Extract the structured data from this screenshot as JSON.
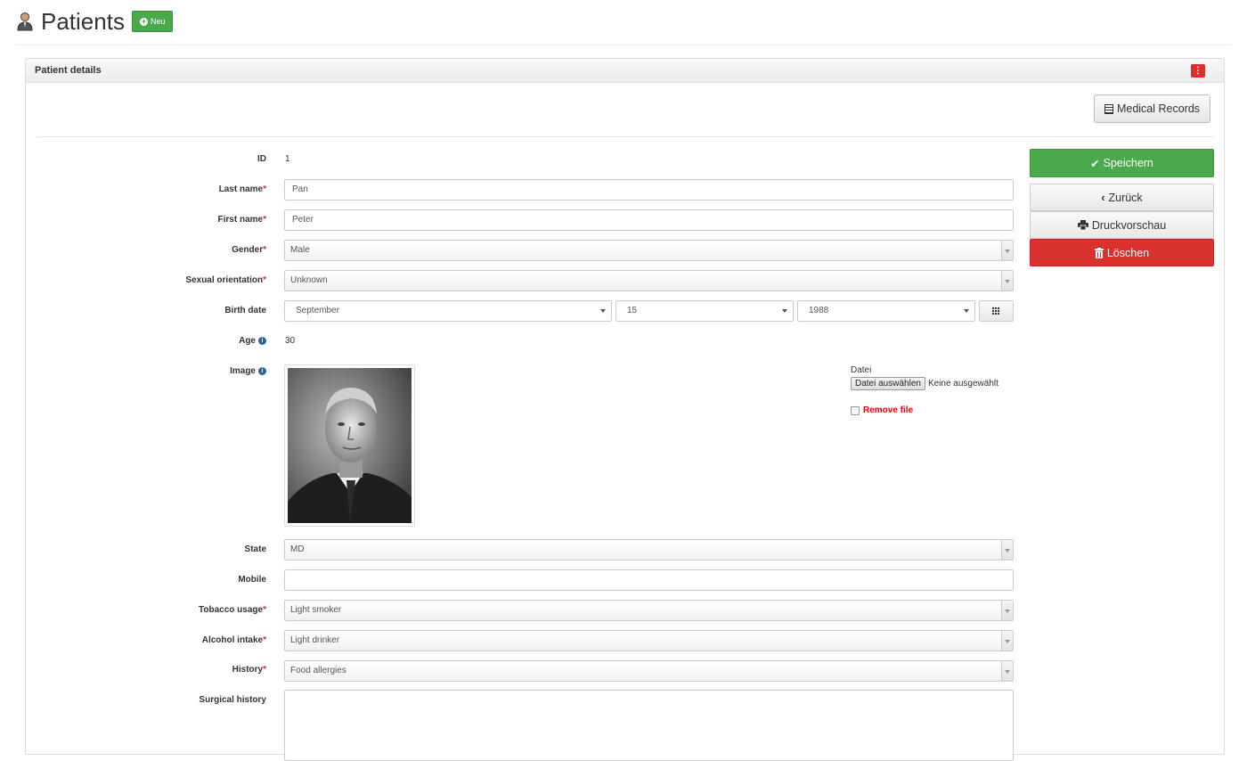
{
  "header": {
    "title": "Patients",
    "new_label": "Neu"
  },
  "panel": {
    "title": "Patient details",
    "records_label": "Medical Records"
  },
  "actions": {
    "save": "Speichern",
    "back": "Zurück",
    "print": "Druckvorschau",
    "delete": "Löschen"
  },
  "form": {
    "id_label": "ID",
    "id_value": "1",
    "lastname_label": "Last name",
    "lastname_value": "Pan",
    "firstname_label": "First name",
    "firstname_value": "Peter",
    "gender_label": "Gender",
    "gender_value": "Male",
    "orientation_label": "Sexual orientation",
    "orientation_value": "Unknown",
    "birth_label": "Birth date",
    "birth_month": "September",
    "birth_day": "15",
    "birth_year": "1988",
    "age_label": "Age",
    "age_value": "30",
    "image_label": "Image",
    "file_label": "Datei",
    "file_button": "Datei auswählen",
    "file_status": "Keine ausgewählt",
    "remove_label": "Remove file",
    "state_label": "State",
    "state_value": "MD",
    "mobile_label": "Mobile",
    "mobile_value": "",
    "tobacco_label": "Tobacco usage",
    "tobacco_value": "Light smoker",
    "alcohol_label": "Alcohol intake",
    "alcohol_value": "Light drinker",
    "history_label": "History",
    "history_value": "Food allergies",
    "surgical_label": "Surgical history",
    "required_mark": "*"
  },
  "colors": {
    "success": "#4aa94a",
    "danger": "#d9322d",
    "info": "#2a6496"
  }
}
